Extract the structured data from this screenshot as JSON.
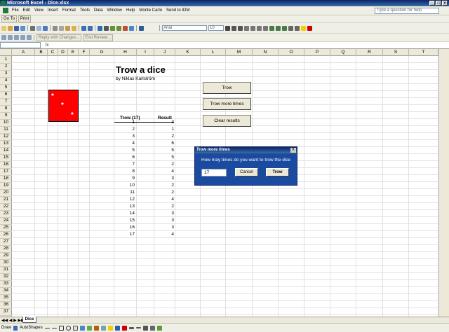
{
  "window": {
    "title": "Microsoft Excel - Dice.xlsx"
  },
  "menu": [
    "File",
    "Edit",
    "View",
    "Insert",
    "Format",
    "Tools",
    "Data",
    "Window",
    "Help",
    "Monte Carlo",
    "Send to IDM"
  ],
  "ask_placeholder": "Type a question for help",
  "toolbar1": {
    "goto": "Go To",
    "print": "Print"
  },
  "toolbar3": {
    "font": "Arial",
    "size": "10",
    "reply": "Reply with Changes...",
    "end_review": "End Review..."
  },
  "formula": {
    "fx": "fx",
    "namebox": ""
  },
  "columns": [
    "A",
    "B",
    "C",
    "D",
    "E",
    "F",
    "G",
    "H",
    "I",
    "J",
    "K",
    "L",
    "M",
    "N",
    "O",
    "P",
    "Q",
    "R",
    "S",
    "T"
  ],
  "rows": [
    "1",
    "2",
    "3",
    "4",
    "5",
    "6",
    "7",
    "8",
    "9",
    "10",
    "11",
    "12",
    "13",
    "14",
    "15",
    "16",
    "17",
    "18",
    "19",
    "20",
    "21",
    "22",
    "23",
    "24",
    "25",
    "26",
    "27",
    "28",
    "29",
    "30",
    "31",
    "32",
    "33",
    "34",
    "35",
    "36",
    "37"
  ],
  "sheet": {
    "title": "Trow a dice",
    "byline": "by Niklas Karlström",
    "die_pips": [
      "*",
      "*",
      "*"
    ],
    "die_color": "#ff0000",
    "header_trow": "Trow (17)",
    "header_result": "Result",
    "trows": [
      "1",
      "2",
      "3",
      "4",
      "5",
      "6",
      "7",
      "8",
      "9",
      "10",
      "11",
      "12",
      "13",
      "14",
      "15",
      "16",
      "17"
    ],
    "results": [
      "3",
      "1",
      "2",
      "6",
      "5",
      "5",
      "2",
      "4",
      "3",
      "2",
      "2",
      "4",
      "2",
      "3",
      "3",
      "3",
      "4"
    ]
  },
  "buttons": {
    "trow": "Trow",
    "trow_more": "Trow more times",
    "clear": "Clear results"
  },
  "dialog": {
    "title": "Trow more times",
    "close": "X",
    "prompt": "How may times do you want to trow the dice",
    "input_value": "17",
    "cancel": "Cancel",
    "ok": "Trow"
  },
  "tabs": {
    "sheet": "Dice"
  },
  "drawbar": {
    "draw": "Draw",
    "autoshapes": "AutoShapes"
  }
}
